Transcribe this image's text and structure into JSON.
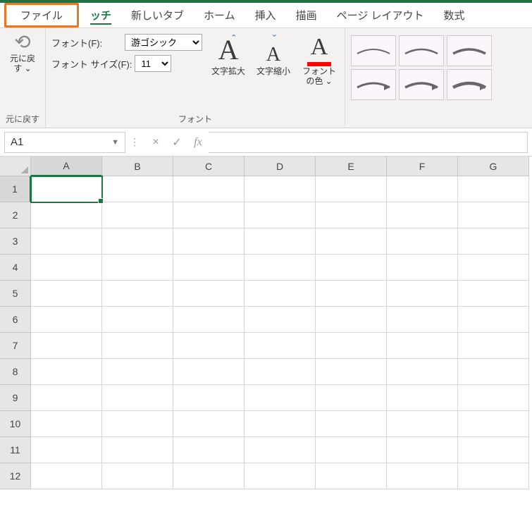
{
  "tabs": {
    "file": "ファイル",
    "touch": "ッチ",
    "new_tab": "新しいタブ",
    "home": "ホーム",
    "insert": "挿入",
    "draw": "描画",
    "page_layout": "ページ レイアウト",
    "formulas": "数式"
  },
  "ribbon": {
    "undo_group_label": "元に戻す",
    "undo_label_line1": "元に戻",
    "undo_label_line2": "す ⌄",
    "font_label": "フォント(F):",
    "font_value": "游ゴシック",
    "font_size_label": "フォント サイズ(F):",
    "font_size_value": "11",
    "grow_font_label": "文字拡大",
    "shrink_font_label": "文字縮小",
    "font_color_label_line1": "フォント",
    "font_color_label_line2": "の色 ⌄",
    "font_group_label": "フォント",
    "colors": {
      "font_color_bar": "#ff0000",
      "accent": "#217346"
    }
  },
  "formula_bar": {
    "name_box": "A1",
    "cancel": "×",
    "confirm": "✓",
    "fx": "fx",
    "formula_value": ""
  },
  "grid": {
    "columns": [
      "A",
      "B",
      "C",
      "D",
      "E",
      "F",
      "G"
    ],
    "rows": [
      1,
      2,
      3,
      4,
      5,
      6,
      7,
      8,
      9,
      10,
      11,
      12
    ],
    "active_cell": "A1"
  }
}
